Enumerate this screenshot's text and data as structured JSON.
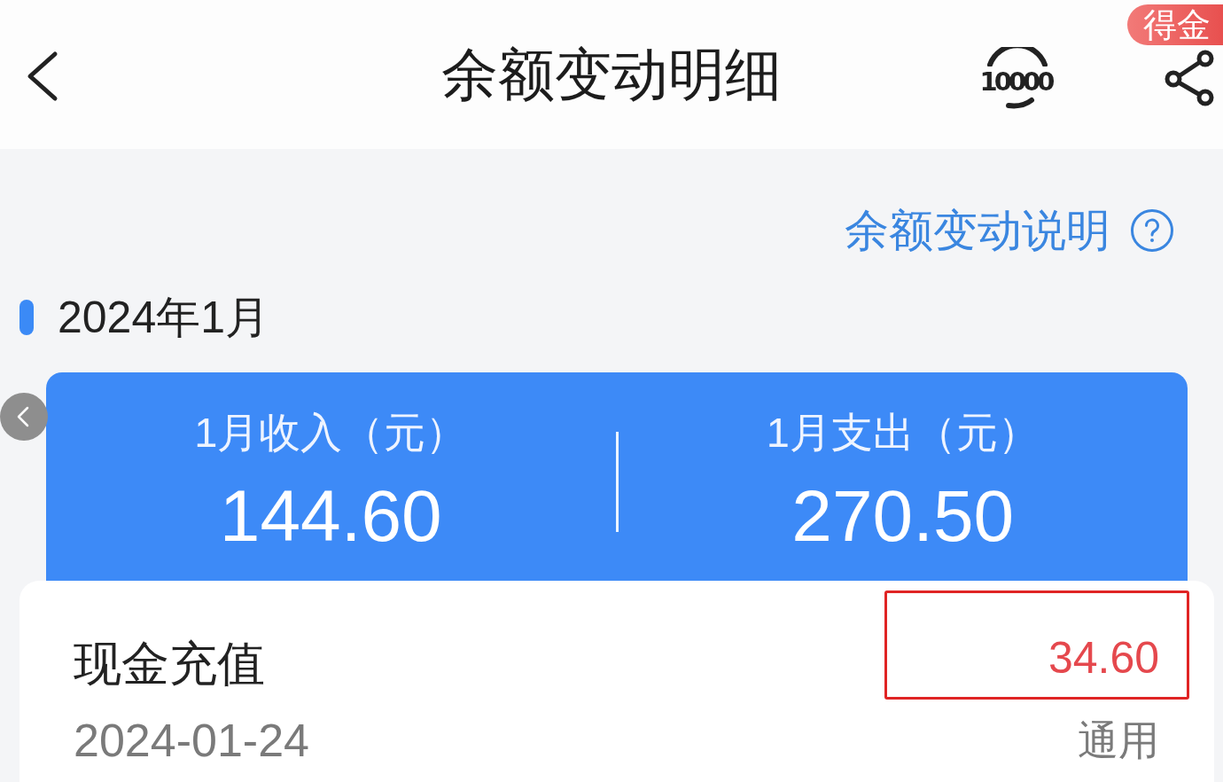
{
  "header": {
    "title": "余额变动明细",
    "headset_label": "10000",
    "badge": "得金"
  },
  "help_link": {
    "label": "余额变动说明"
  },
  "month": {
    "label": "2024年1月"
  },
  "summary": [
    {
      "label": "1月收入（元）",
      "value": "144.60"
    },
    {
      "label": "1月支出（元）",
      "value": "270.50"
    }
  ],
  "transactions": [
    {
      "title": "现金充值",
      "date": "2024-01-24",
      "amount": "34.60",
      "kind": "income",
      "account": "通用",
      "highlighted": true
    }
  ]
}
